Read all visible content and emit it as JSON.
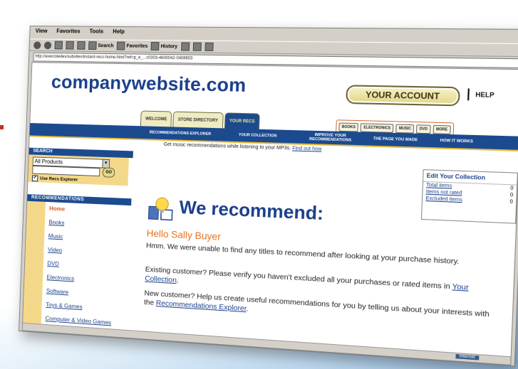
{
  "browser": {
    "menu": [
      "View",
      "Favorites",
      "Tools",
      "Help"
    ],
    "toolbar": {
      "search": "Search",
      "favorites": "Favorites",
      "history": "History"
    },
    "address": "http://avec/otedev/subsites/instant-recs-home.html?ref=p_e_...c0303-4600042-0408603"
  },
  "header": {
    "logo": "companywebsite.com",
    "account": "YOUR ACCOUNT",
    "help": "HELP"
  },
  "tabs": [
    {
      "label": "WELCOME"
    },
    {
      "label": "STORE DIRECTORY"
    },
    {
      "label": "YOUR RECS"
    }
  ],
  "mini_buttons": [
    "BOOKS",
    "ELECTRONICS",
    "MUSIC",
    "DVD",
    "MORE"
  ],
  "navbar": [
    "RECOMMENDATIONS EXPLORER",
    "YOUR COLLECTION",
    "IMPROVE YOUR RECOMMENDATIONS",
    "THE PAGE YOU MADE",
    "HOW IT WORKS"
  ],
  "subbar": {
    "text": "Get music recommendations while listening to your MP3s.",
    "link": "Find out how"
  },
  "search": {
    "header": "SEARCH",
    "select": "All Products",
    "go": "GO",
    "checkbox": "Use Recs Explorer"
  },
  "recommendations": {
    "header": "RECOMMENDATIONS",
    "items": [
      "Home",
      "Books",
      "Music",
      "Video",
      "DVD",
      "Electronics",
      "Software",
      "Toys & Games",
      "Computer & Video Games"
    ]
  },
  "main": {
    "title": "We recommend:",
    "greeting": "Hello Sally Buyer",
    "p1": "Hmm. We were unable to find any titles to recommend after looking at your purchase history.",
    "p2_pre": "Existing customer? Please verify you haven't excluded all your purchases or rated items in ",
    "p2_link": "Your Collection",
    "p2_post": ".",
    "p3_pre": "New customer? Help us create useful recommendations for you by telling us about your interests with the ",
    "p3_link": "Recommendations Explorer",
    "p3_post": "."
  },
  "edit_collection": {
    "title": "Edit Your Collection",
    "rows": [
      {
        "label": "Total items",
        "value": "0"
      },
      {
        "label": "Items not rated",
        "value": "0"
      },
      {
        "label": "Excluded items",
        "value": "0"
      }
    ]
  },
  "status": {
    "zone": "Internet"
  },
  "colors": {
    "brand_blue": "#1c4a8f",
    "accent_orange": "#e5711e",
    "side_gold": "#f4d88a"
  }
}
